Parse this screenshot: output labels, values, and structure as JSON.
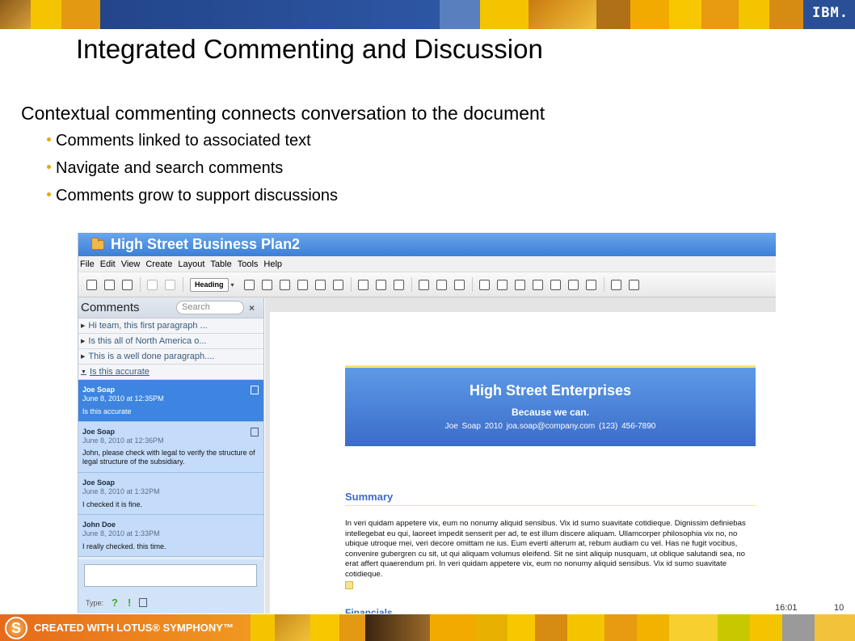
{
  "top_banner": {
    "brand": "IBM."
  },
  "slide": {
    "title": "Integrated Commenting and Discussion",
    "lead": "Contextual commenting connects conversation to the document",
    "bullets": [
      "Comments linked to associated text",
      "Navigate and search comments",
      "Comments grow to support discussions"
    ]
  },
  "app": {
    "title": "High Street Business Plan2",
    "menu": [
      "File",
      "Edit",
      "View",
      "Create",
      "Layout",
      "Table",
      "Tools",
      "Help"
    ],
    "toolbar": {
      "style_select": "Heading"
    }
  },
  "comments": {
    "title": "Comments",
    "search_placeholder": "Search",
    "close": "×",
    "threads": [
      "Hi team, this first paragraph ...",
      "Is this all of North America o...",
      "This is a well done paragraph....",
      "Is this accurate"
    ],
    "entries": [
      {
        "author": "Joe Soap",
        "date": "June 8, 2010 at 12:35PM",
        "text": "Is this accurate"
      },
      {
        "author": "Joe Soap",
        "date": "June 8, 2010 at 12:36PM",
        "text": "John, please check with legal to verify the structure of legal structure of the subsidiary."
      },
      {
        "author": "Joe Soap",
        "date": "June 8, 2010 at 1:32PM",
        "text": "I checked it is fine."
      },
      {
        "author": "John Doe",
        "date": "June 8, 2010 at 1:33PM",
        "text": "I really checked. this time."
      }
    ],
    "type_label": "Type:"
  },
  "document": {
    "company": "High Street Enterprises",
    "tagline": "Because we can.",
    "contact": "Joe Soap   2010   joa.soap@company.com   (123) 456-7890",
    "summary_heading": "Summary",
    "summary_text": "In veri quidam appetere vix, eum no nonumy aliquid sensibus. Vix id sumo suavitate cotidieque. Dignissim definiebas intellegebat eu qui, laoreet impedit senserit per ad, te est illum discere aliquam. Ullamcorper philosophia vix no, no ubique utroque mei, veri decore omittam ne ius. Eum everti alterum at, rebum audiam cu vel. Has ne fugit vocibus, convenire gubergren cu sit, ut qui aliquam volumus eleifend. Sit ne sint aliquip nusquam, ut oblique salutandi sea, no erat affert quaerendum pri. In veri quidam appetere vix, eum no nonumy aliquid sensibus. Vix id sumo suavitate cotidieque.",
    "next_heading": "Financials"
  },
  "footer": {
    "time": "16:01",
    "page": "10",
    "lotus_text": "CREATED WITH LOTUS® SYMPHONY™"
  },
  "colors": {
    "accent_yellow": "#f5b800",
    "banner_blue": "#2a4f96",
    "lotus_orange": "#e66a1b",
    "comment_active": "#3d85e0",
    "comment_bg": "#c4dcfa"
  }
}
